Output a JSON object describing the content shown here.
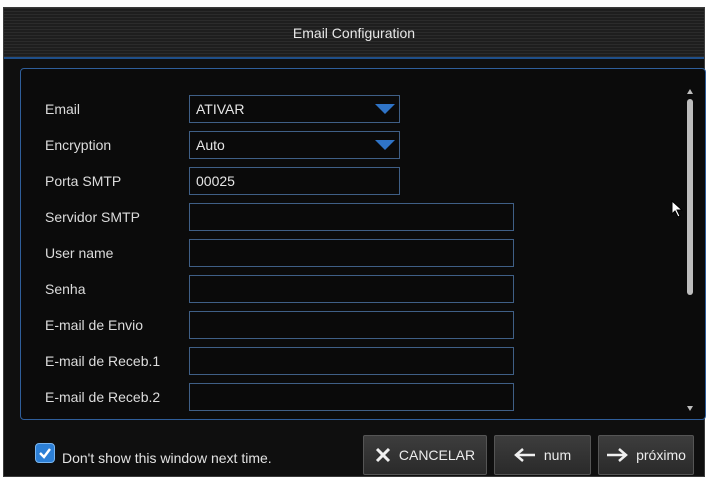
{
  "dialog": {
    "title": "Email Configuration"
  },
  "form": {
    "email": {
      "label": "Email",
      "value": "ATIVAR"
    },
    "encryption": {
      "label": "Encryption",
      "value": "Auto"
    },
    "smtp_port": {
      "label": "Porta SMTP",
      "value": "00025"
    },
    "smtp_server": {
      "label": "Servidor SMTP",
      "value": ""
    },
    "user_name": {
      "label": "User name",
      "value": ""
    },
    "password": {
      "label": "Senha",
      "value": ""
    },
    "sender_email": {
      "label": "E-mail de Envio",
      "value": ""
    },
    "receiver_email_1": {
      "label": "E-mail de Receb.1",
      "value": ""
    },
    "receiver_email_2": {
      "label": "E-mail de Receb.2",
      "value": ""
    }
  },
  "footer": {
    "dont_show_label": "Don't show this window next time.",
    "dont_show_checked": true,
    "cancel_label": "CANCELAR",
    "prev_label": "num",
    "next_label": "próximo"
  },
  "colors": {
    "accent": "#2f5e9a",
    "checkbox": "#2c7fd6",
    "dropdown_arrow": "#2f74c7",
    "background": "#0f0f0f"
  },
  "icons": {
    "dropdown": "chevron-down-icon",
    "cancel": "close-icon",
    "prev": "arrow-left-icon",
    "next": "arrow-right-icon",
    "checkbox": "checkmark-icon",
    "cursor": "mouse-pointer-icon"
  }
}
